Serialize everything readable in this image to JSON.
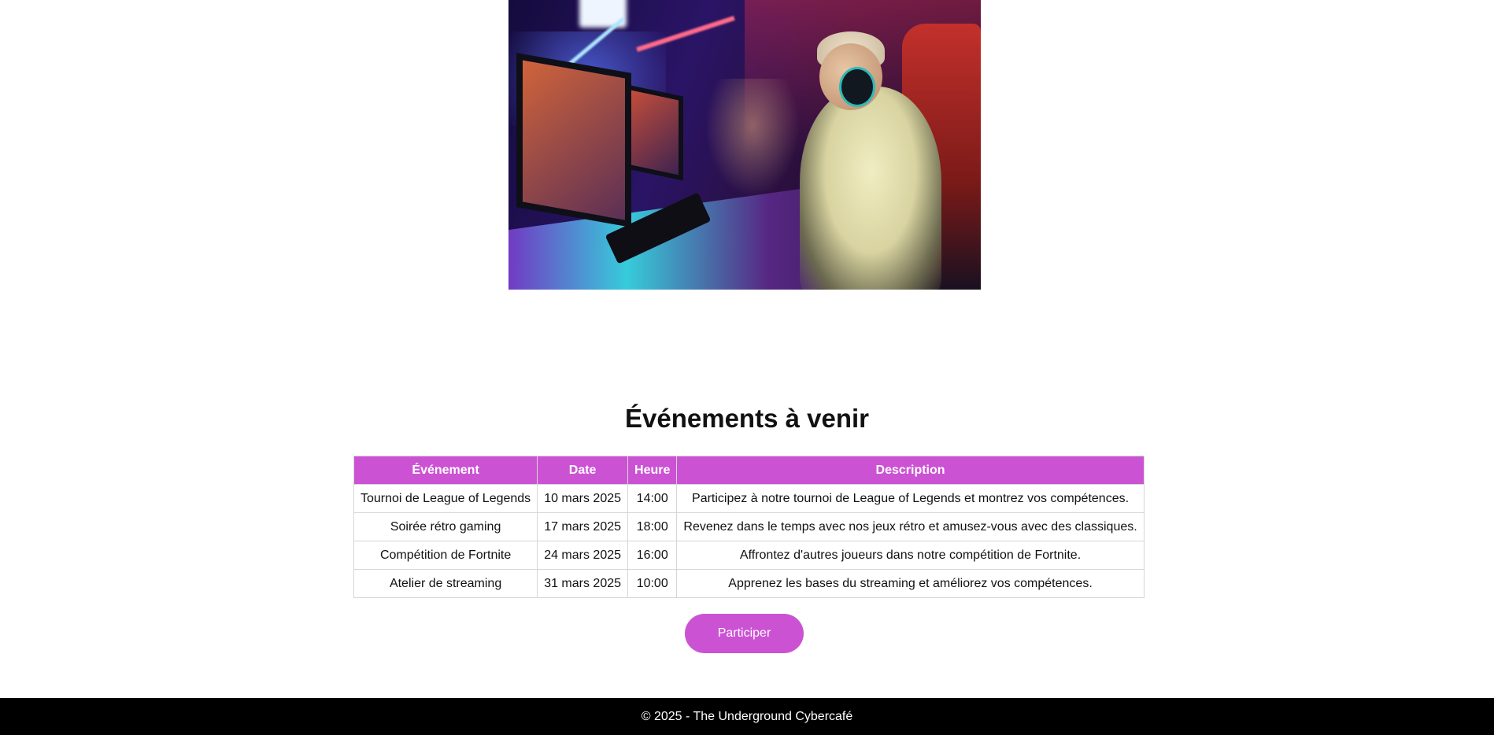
{
  "hero": {
    "image_alt": "gaming-room-photo"
  },
  "events": {
    "title": "Événements à venir",
    "columns": [
      "Événement",
      "Date",
      "Heure",
      "Description"
    ],
    "rows": [
      [
        "Tournoi de League of Legends",
        "10 mars 2025",
        "14:00",
        "Participez à notre tournoi de League of Legends et montrez vos compétences."
      ],
      [
        "Soirée rétro gaming",
        "17 mars 2025",
        "18:00",
        "Revenez dans le temps avec nos jeux rétro et amusez-vous avec des classiques."
      ],
      [
        "Compétition de Fortnite",
        "24 mars 2025",
        "16:00",
        "Affrontez d'autres joueurs dans notre compétition de Fortnite."
      ],
      [
        "Atelier de streaming",
        "31 mars 2025",
        "10:00",
        "Apprenez les bases du streaming et améliorez vos compétences."
      ]
    ],
    "button_label": "Participer"
  },
  "footer": {
    "text": "© 2025 - The Underground Cybercafé"
  },
  "colors": {
    "accent": "#cc52d4",
    "footer_bg": "#000000",
    "border": "#d6d6d6"
  }
}
